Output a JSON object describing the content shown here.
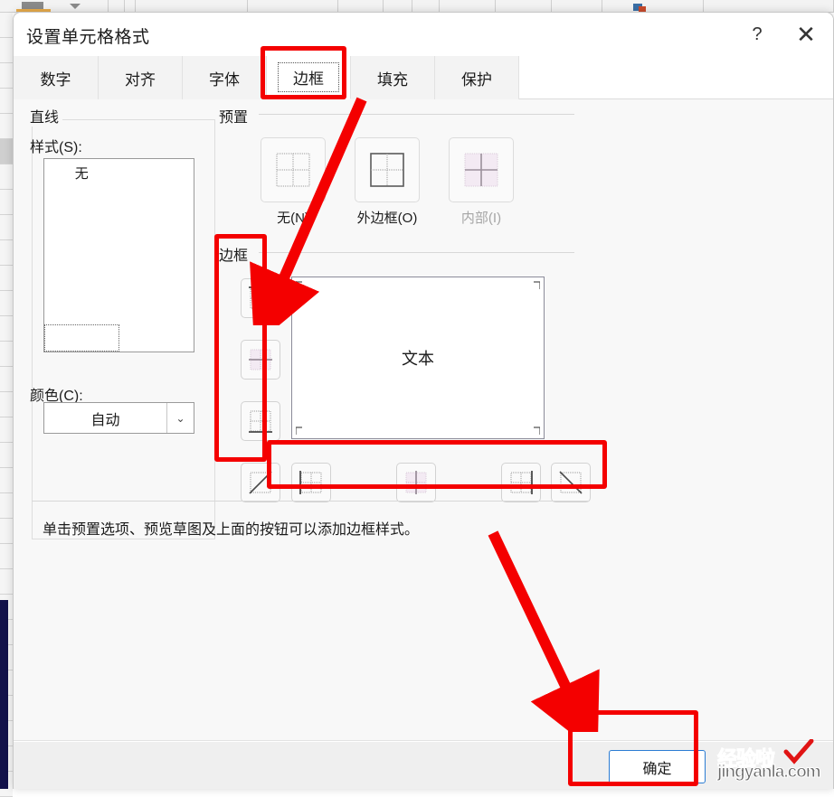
{
  "dialog": {
    "title": "设置单元格格式",
    "help_icon": "?",
    "close_icon": "✕"
  },
  "tabs": [
    {
      "label": "数字",
      "active": false
    },
    {
      "label": "对齐",
      "active": false
    },
    {
      "label": "字体",
      "active": false
    },
    {
      "label": "边框",
      "active": true
    },
    {
      "label": "填充",
      "active": false
    },
    {
      "label": "保护",
      "active": false
    }
  ],
  "line_group": {
    "title": "直线",
    "style_label": "样式(S):",
    "color_label": "颜色(C):",
    "color_value": "自动",
    "chevron_icon": "⌄",
    "none_label": "无",
    "styles_left": [
      "无",
      "dotted-fine",
      "dotted",
      "dash-dot",
      "dash-dot-long",
      "dashed",
      "thin-solid-selected"
    ],
    "styles_right": [
      "dash-dot-medium",
      "dash-dense-bold",
      "dash-dot-bold",
      "dashed-bold",
      "solid-medium",
      "solid-thick",
      "double"
    ]
  },
  "preset_group": {
    "title": "预置",
    "items": [
      {
        "label": "无(N)",
        "icon": "preset-none-icon",
        "disabled": false
      },
      {
        "label": "外边框(O)",
        "icon": "preset-outline-icon",
        "disabled": false
      },
      {
        "label": "内部(I)",
        "icon": "preset-inside-icon",
        "disabled": true
      }
    ]
  },
  "border_group": {
    "title": "边框",
    "left_buttons": [
      {
        "name": "border-top-button",
        "icon": "border-top-icon"
      },
      {
        "name": "border-middle-horizontal-button",
        "icon": "border-middle-horizontal-icon"
      },
      {
        "name": "border-bottom-button",
        "icon": "border-bottom-icon"
      },
      {
        "name": "border-diagonal-up-button",
        "icon": "border-diagonal-up-icon"
      }
    ],
    "bottom_buttons": [
      {
        "name": "border-left-button",
        "icon": "border-left-icon"
      },
      {
        "name": "border-middle-vertical-button",
        "icon": "border-middle-vertical-icon"
      },
      {
        "name": "border-right-button",
        "icon": "border-right-icon"
      },
      {
        "name": "border-diagonal-down-button",
        "icon": "border-diagonal-down-icon"
      }
    ],
    "preview_text": "文本"
  },
  "hint": "单击预置选项、预览草图及上面的按钮可以添加边框样式。",
  "footer": {
    "ok_label": "确定"
  },
  "watermark": {
    "line1": "经验啦",
    "line2": "jingyanla.com",
    "check": "✓"
  },
  "colors": {
    "annotation_red": "#f40000",
    "accent_blue": "#2b7cd3",
    "dialog_bg": "#f8f8f8",
    "footer_bg": "#efefef"
  }
}
